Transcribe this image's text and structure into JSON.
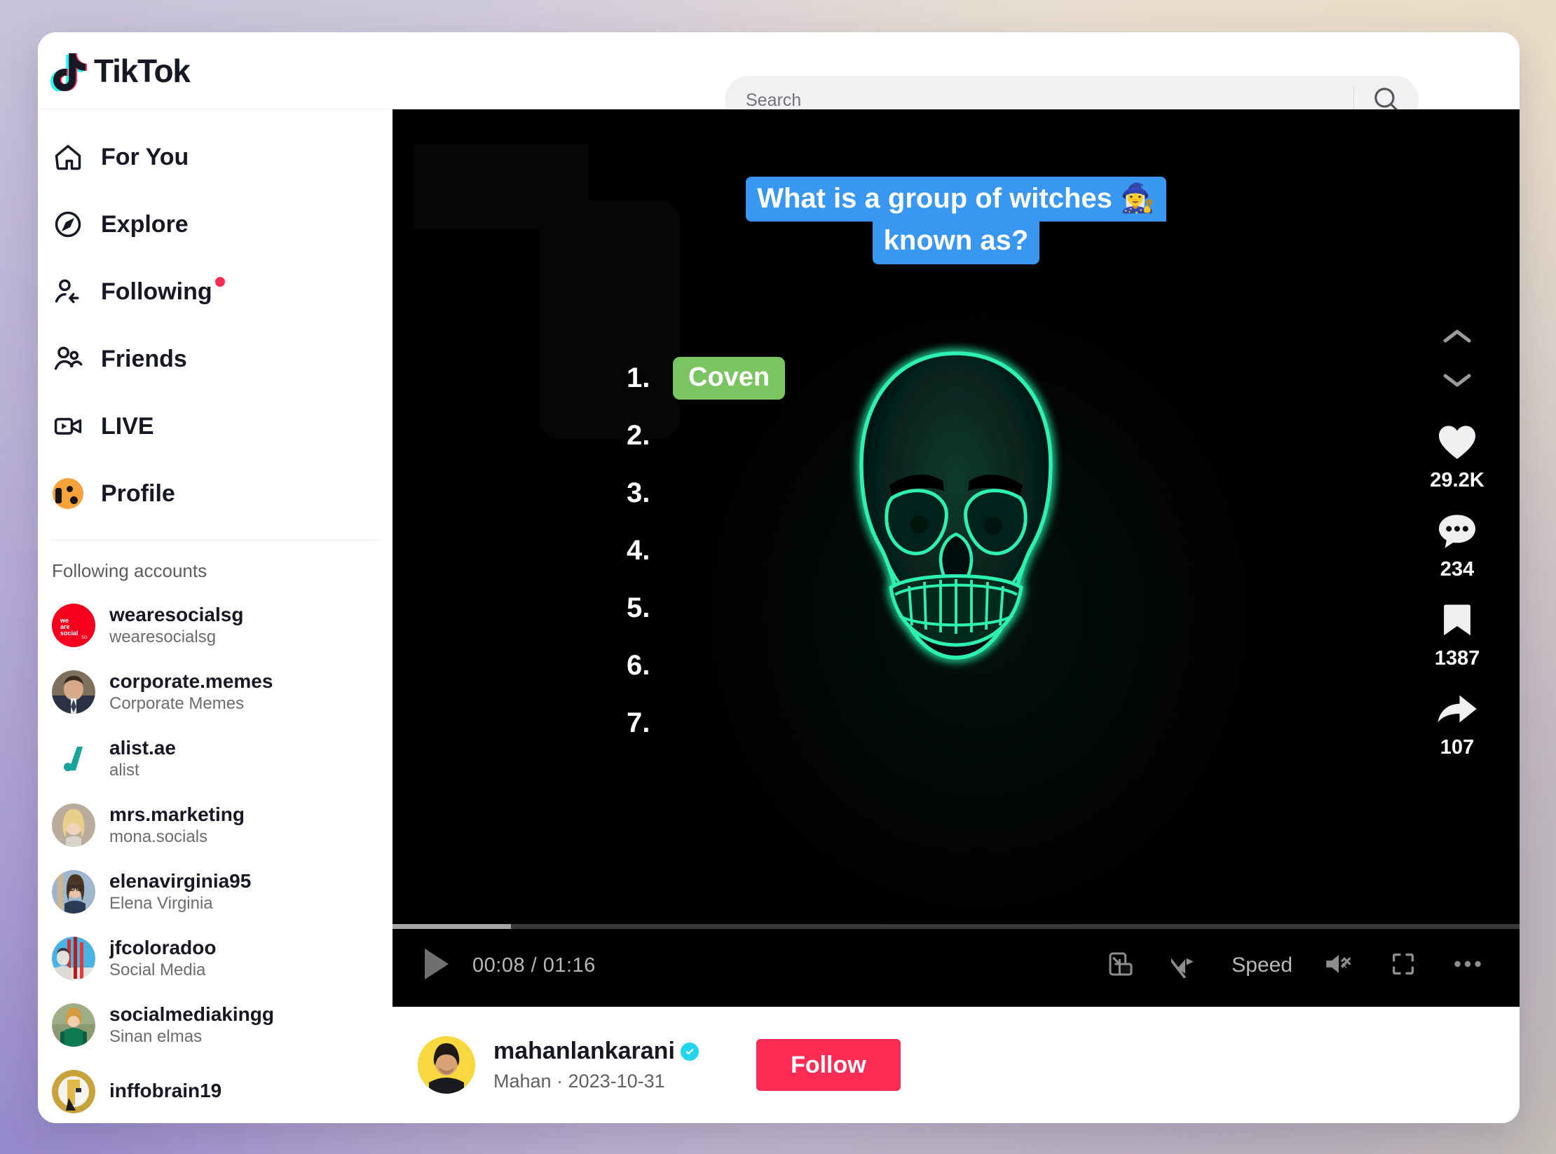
{
  "header": {
    "brand": "TikTok",
    "search": {
      "placeholder": "Search",
      "value": "",
      "icon": "search-icon"
    }
  },
  "sidebar": {
    "nav": [
      {
        "label": "For You",
        "icon": "home-icon",
        "badge": false
      },
      {
        "label": "Explore",
        "icon": "compass-icon",
        "badge": false
      },
      {
        "label": "Following",
        "icon": "person-add-icon",
        "badge": true
      },
      {
        "label": "Friends",
        "icon": "people-icon",
        "badge": false
      },
      {
        "label": "LIVE",
        "icon": "live-video-icon",
        "badge": false
      },
      {
        "label": "Profile",
        "icon": "avatar-icon",
        "badge": false
      }
    ],
    "following_heading": "Following accounts",
    "accounts": [
      {
        "username": "wearesocialsg",
        "display_name": "wearesocialsg",
        "avatar_color": "#f4001e"
      },
      {
        "username": "corporate.memes",
        "display_name": "Corporate Memes",
        "avatar_color": "#6b6150"
      },
      {
        "username": "alist.ae",
        "display_name": "alist",
        "avatar_color": "#ffffff"
      },
      {
        "username": "mrs.marketing",
        "display_name": "mona.socials",
        "avatar_color": "#b9a694"
      },
      {
        "username": "elenavirginia95",
        "display_name": "Elena Virginia",
        "avatar_color": "#8fa9c6"
      },
      {
        "username": "jfcoloradoo",
        "display_name": "Social Media",
        "avatar_color": "#3fa8d8"
      },
      {
        "username": "socialmediakingg",
        "display_name": "Sinan elmas",
        "avatar_color": "#8fa878"
      },
      {
        "username": "inffobrain19",
        "display_name": "",
        "avatar_color": "#c8a33c"
      }
    ]
  },
  "video": {
    "caption": {
      "line1": "What is a group of witches 🧙‍♀️",
      "line2": "known as?",
      "bg_color": "#3897f0"
    },
    "answers": [
      {
        "number": "1.",
        "text": "Coven",
        "revealed": true
      },
      {
        "number": "2.",
        "text": "",
        "revealed": false
      },
      {
        "number": "3.",
        "text": "",
        "revealed": false
      },
      {
        "number": "4.",
        "text": "",
        "revealed": false
      },
      {
        "number": "5.",
        "text": "",
        "revealed": false
      },
      {
        "number": "6.",
        "text": "",
        "revealed": false
      },
      {
        "number": "7.",
        "text": "",
        "revealed": false
      }
    ],
    "answer_pill_color": "#7ac462",
    "rail": {
      "prev_icon": "chevron-up-icon",
      "next_icon": "chevron-down-icon",
      "actions": [
        {
          "icon": "heart-icon",
          "count": "29.2K"
        },
        {
          "icon": "comment-icon",
          "count": "234"
        },
        {
          "icon": "bookmark-icon",
          "count": "1387"
        },
        {
          "icon": "share-icon",
          "count": "107"
        }
      ]
    },
    "controls": {
      "play_icon": "play-icon",
      "current_time": "00:08",
      "duration": "01:16",
      "time_display": "00:08 / 01:16",
      "progress_percent": 10.5,
      "buttons": [
        {
          "icon": "picture-in-picture-icon",
          "label": ""
        },
        {
          "icon": "autoscroll-off-icon",
          "label": ""
        },
        {
          "icon": "speed-label",
          "label": "Speed"
        },
        {
          "icon": "volume-muted-icon",
          "label": ""
        },
        {
          "icon": "fullscreen-icon",
          "label": ""
        },
        {
          "icon": "more-options-icon",
          "label": ""
        }
      ],
      "speed_label": "Speed"
    }
  },
  "author": {
    "handle": "mahanlankarani",
    "verified": true,
    "display_name": "Mahan",
    "date": "2023-10-31",
    "meta_line": "Mahan · 2023-10-31",
    "follow_label": "Follow",
    "follow_color": "#fe2c55"
  }
}
